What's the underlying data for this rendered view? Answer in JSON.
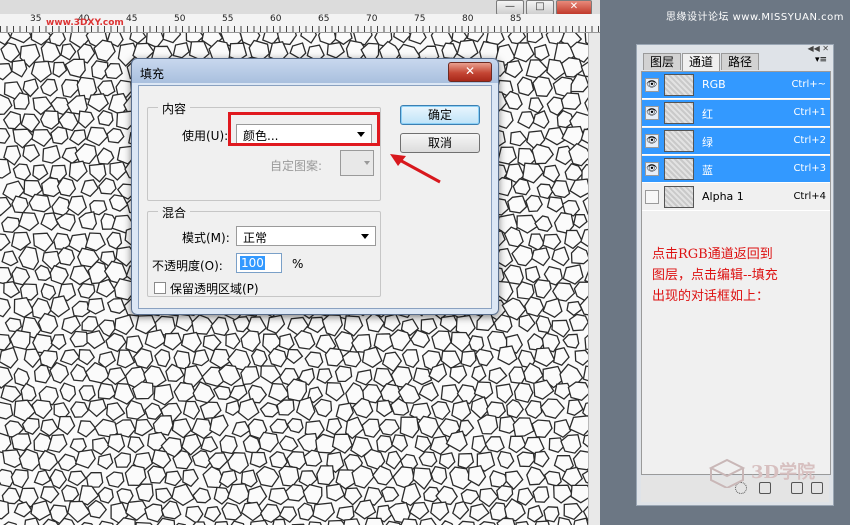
{
  "site_header": "思缘设计论坛 www.MISSYUAN.com",
  "canvas": {
    "ruler_labels": [
      "35",
      "40",
      "45",
      "50",
      "55",
      "60",
      "65",
      "70",
      "75",
      "80",
      "85"
    ],
    "watermark": "www.3DXY.com"
  },
  "window_controls": {
    "minimize": "—",
    "restore": "□",
    "close": "✕"
  },
  "dialog": {
    "title": "填充",
    "close_label": "✕",
    "contents_group": "内容",
    "use_label": "使用(U):",
    "use_value": "颜色...",
    "custom_pattern_label": "自定图案:",
    "blend_group": "混合",
    "mode_label": "模式(M):",
    "mode_value": "正常",
    "opacity_label": "不透明度(O):",
    "opacity_value": "100",
    "opacity_unit": "%",
    "preserve_label": "保留透明区域(P)",
    "preserve_checked": false,
    "ok_label": "确定",
    "cancel_label": "取消"
  },
  "panel": {
    "tabs": [
      "图层",
      "通道",
      "路径"
    ],
    "active_tab": 1,
    "channels": [
      {
        "name": "RGB",
        "shortcut": "Ctrl+~",
        "selected": true,
        "visible": true
      },
      {
        "name": "红",
        "shortcut": "Ctrl+1",
        "selected": true,
        "visible": true
      },
      {
        "name": "绿",
        "shortcut": "Ctrl+2",
        "selected": true,
        "visible": true
      },
      {
        "name": "蓝",
        "shortcut": "Ctrl+3",
        "selected": true,
        "visible": true
      },
      {
        "name": "Alpha 1",
        "shortcut": "Ctrl+4",
        "selected": false,
        "visible": false
      }
    ],
    "eye_glyph": "👁"
  },
  "annotation_note": "点击RGB通道返回到图层，点击编辑--填充 出现的对话框如上：",
  "logo_text": "3D学院",
  "colors": {
    "highlight": "#e0191f",
    "selection": "#3399ff",
    "note": "#d11111"
  }
}
